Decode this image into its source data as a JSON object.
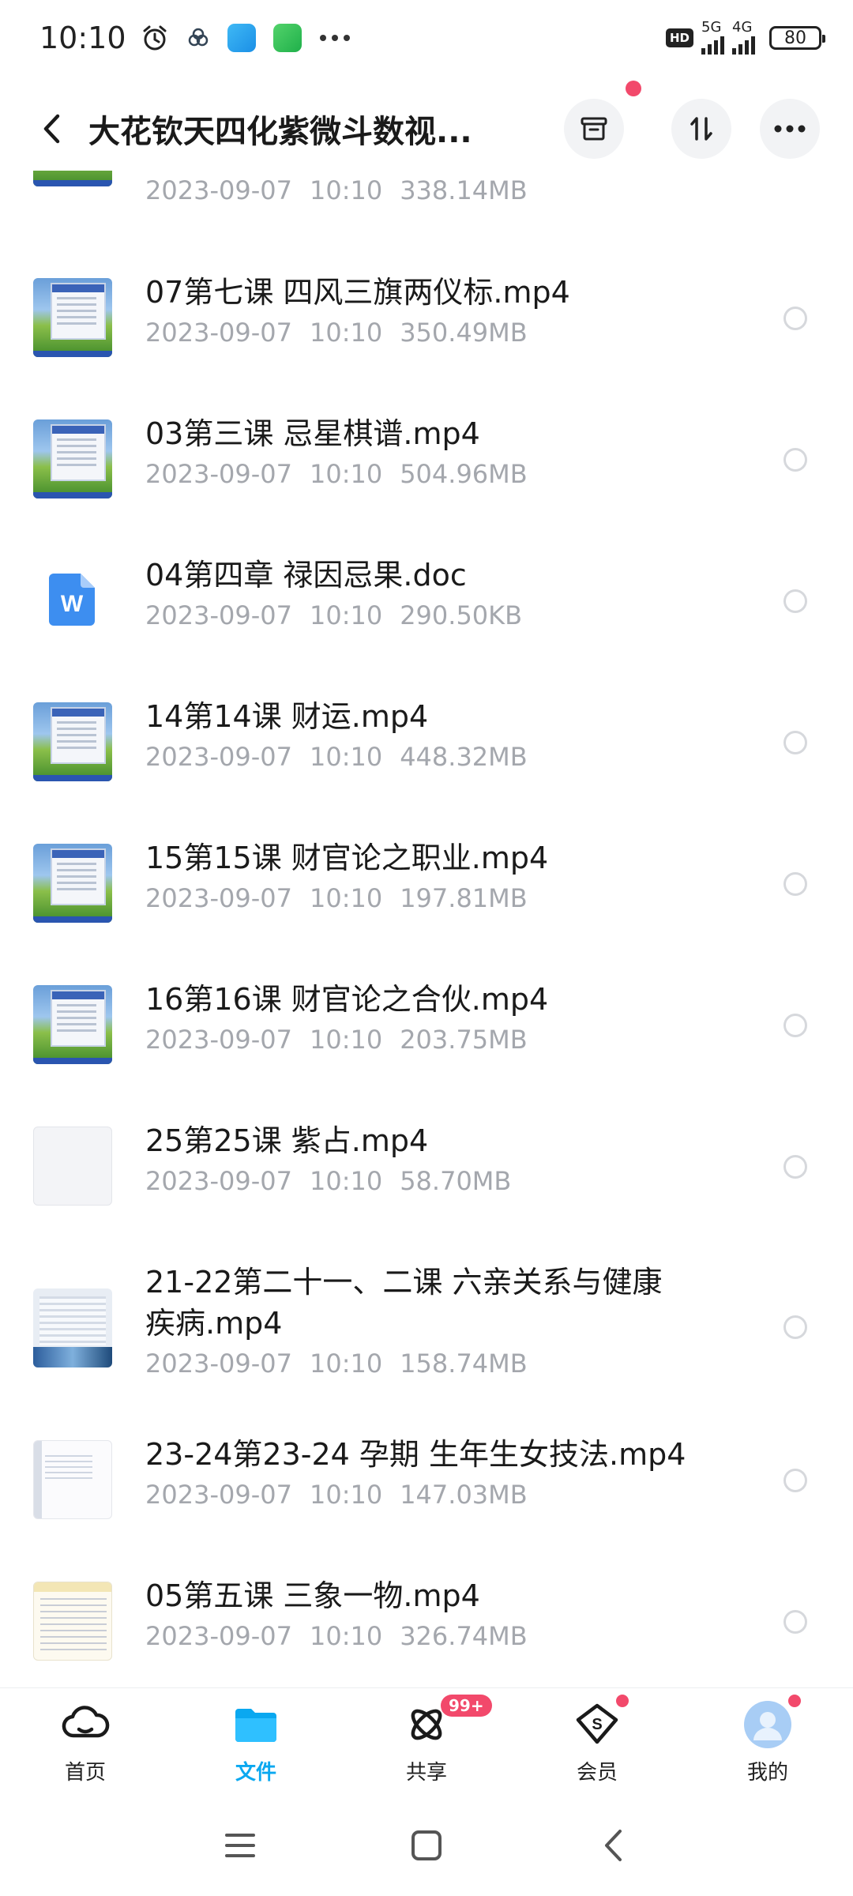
{
  "status_bar": {
    "time": "10:10",
    "hd_badge": "HD",
    "signal1_label": "5G",
    "signal2_label": "4G",
    "battery": "80"
  },
  "header": {
    "title": "大花钦天四化紫微斗数视..."
  },
  "files": [
    {
      "name": "",
      "date": "2023-09-07",
      "time": "10:10",
      "size": "338.14MB",
      "thumb": "xp"
    },
    {
      "name": "07第七课 四风三旗两仪标.mp4",
      "date": "2023-09-07",
      "time": "10:10",
      "size": "350.49MB",
      "thumb": "xp"
    },
    {
      "name": "03第三课 忌星棋谱.mp4",
      "date": "2023-09-07",
      "time": "10:10",
      "size": "504.96MB",
      "thumb": "xp"
    },
    {
      "name": "04第四章 禄因忌果.doc",
      "date": "2023-09-07",
      "time": "10:10",
      "size": "290.50KB",
      "thumb": "word",
      "icon_letter": "W"
    },
    {
      "name": "14第14课 财运.mp4",
      "date": "2023-09-07",
      "time": "10:10",
      "size": "448.32MB",
      "thumb": "xp"
    },
    {
      "name": "15第15课 财官论之职业.mp4",
      "date": "2023-09-07",
      "time": "10:10",
      "size": "197.81MB",
      "thumb": "xp"
    },
    {
      "name": "16第16课 财官论之合伙.mp4",
      "date": "2023-09-07",
      "time": "10:10",
      "size": "203.75MB",
      "thumb": "xp"
    },
    {
      "name": "25第25课 紫占.mp4",
      "date": "2023-09-07",
      "time": "10:10",
      "size": "58.70MB",
      "thumb": "blank"
    },
    {
      "name": "21-22第二十一、二课 六亲关系与健康疾病.mp4",
      "date": "2023-09-07",
      "time": "10:10",
      "size": "158.74MB",
      "thumb": "screen"
    },
    {
      "name": "23-24第23-24 孕期 生年生女技法.mp4",
      "date": "2023-09-07",
      "time": "10:10",
      "size": "147.03MB",
      "thumb": "white"
    },
    {
      "name": "05第五课 三象一物.mp4",
      "date": "2023-09-07",
      "time": "10:10",
      "size": "326.74MB",
      "thumb": "paper"
    }
  ],
  "tabbar": {
    "tabs": [
      {
        "label": "首页",
        "icon": "cloud-home-icon"
      },
      {
        "label": "文件",
        "icon": "folder-icon"
      },
      {
        "label": "共享",
        "icon": "share-atom-icon",
        "badge": "99+"
      },
      {
        "label": "会员",
        "icon": "member-diamond-icon"
      },
      {
        "label": "我的",
        "icon": "avatar-icon"
      }
    ]
  },
  "colors": {
    "accent": "#0aa8f0",
    "badge_red": "#f2496b",
    "meta_gray": "#a4a7ad"
  }
}
